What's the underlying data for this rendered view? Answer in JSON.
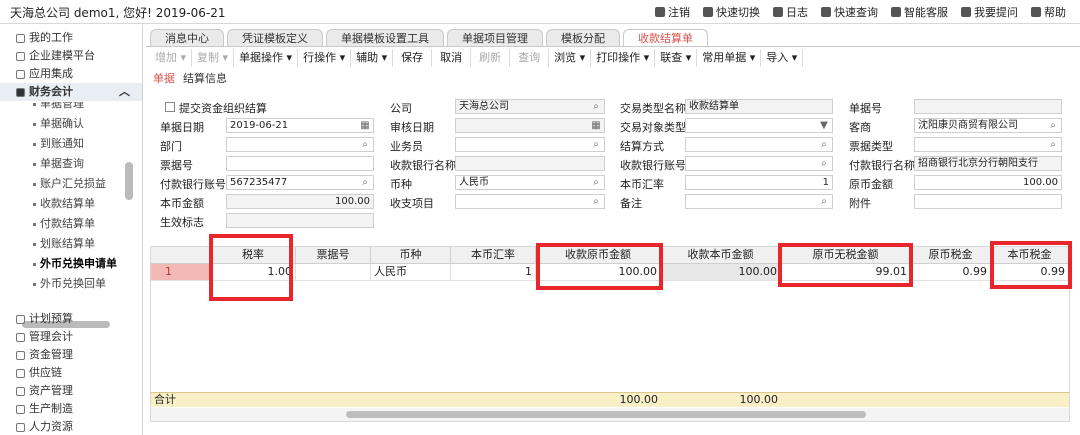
{
  "header": {
    "title": "天海总公司 demo1, 您好! 2019-06-21",
    "links": [
      "注销",
      "快速切换",
      "日志",
      "快速查询",
      "智能客服",
      "我要提问",
      "帮助"
    ]
  },
  "sidebar": {
    "top_items": [
      "我的工作",
      "企业建模平台",
      "应用集成"
    ],
    "active_module": "财务会计",
    "sub_items": [
      "单据管理",
      "单据确认",
      "到账通知",
      "单据查询",
      "账户汇兑损益",
      "收款结算单",
      "付款结算单",
      "划账结算单",
      "外币兑换申请单",
      "外币兑换回单"
    ],
    "bottom_items": [
      "计划预算",
      "管理会计",
      "资金管理",
      "供应链",
      "资产管理",
      "生产制造",
      "人力资源"
    ]
  },
  "tabs": [
    "消息中心",
    "凭证模板定义",
    "单据模板设置工具",
    "单据项目管理",
    "模板分配",
    "收款结算单"
  ],
  "toolbar": [
    "增加 ▾",
    "复制 ▾",
    "单据操作 ▾",
    "行操作 ▾",
    "辅助 ▾",
    "保存",
    "取消",
    "刷新",
    "查询",
    "浏览 ▾",
    "打印操作 ▾",
    "联查 ▾",
    "常用单据 ▾",
    "导入 ▾"
  ],
  "subtabs": [
    "单据",
    "结算信息"
  ],
  "form": {
    "submit_org_label": "提交资金组织结算",
    "company_label": "公司",
    "company_value": "天海总公司",
    "trade_type_label": "交易类型名称",
    "trade_type_value": "收款结算单",
    "doc_no_label": "单据号",
    "doc_no_value": "",
    "doc_date_label": "单据日期",
    "doc_date_value": "2019-06-21",
    "audit_date_label": "审核日期",
    "audit_date_value": "",
    "trade_obj_label": "交易对象类型",
    "trade_obj_value": "",
    "customer_label": "客商",
    "customer_value": "沈阳康贝商贸有限公司",
    "dept_label": "部门",
    "dept_value": "",
    "staff_label": "业务员",
    "staff_value": "",
    "settle_label": "结算方式",
    "settle_value": "",
    "bill_type_label": "票据类型",
    "bill_type_value": "",
    "bill_no_label": "票据号",
    "bill_no_value": "",
    "recv_bank_name_label": "收款银行名称",
    "recv_bank_name_value": "",
    "recv_bank_acct_label": "收款银行账号",
    "recv_bank_acct_value": "",
    "pay_bank_name_label": "付款银行名称",
    "pay_bank_name_value": "招商银行北京分行朝阳支行",
    "pay_bank_acct_label": "付款银行账号",
    "pay_bank_acct_value": "567235477",
    "currency_label": "币种",
    "currency_value": "人民币",
    "rate_label": "本币汇率",
    "rate_value": "1",
    "orig_amount_label": "原币金额",
    "orig_amount_value": "100.00",
    "local_amount_label": "本币金额",
    "local_amount_value": "100.00",
    "income_label": "收支项目",
    "income_value": "",
    "remark_label": "备注",
    "remark_value": "",
    "attach_label": "附件",
    "attach_value": "",
    "effective_label": "生效标志",
    "effective_value": ""
  },
  "grid": {
    "columns": [
      "税率",
      "票据号",
      "币种",
      "本币汇率",
      "收款原币金额",
      "收款本币金额",
      "原币无税金额",
      "原币税金",
      "本币税金"
    ],
    "row": {
      "num": "1",
      "values": [
        "1.00",
        "",
        "人民币",
        "1",
        "100.00",
        "100.00",
        "99.01",
        "0.99",
        "0.99"
      ]
    },
    "total_label": "合计",
    "totals": {
      "recv_orig": "100.00",
      "recv_local": "100.00"
    }
  }
}
